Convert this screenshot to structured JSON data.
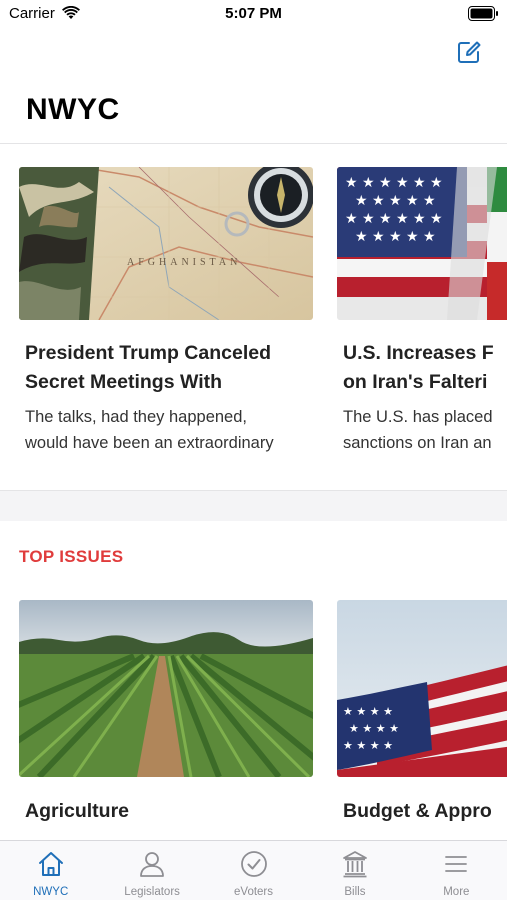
{
  "status_bar": {
    "carrier": "Carrier",
    "time": "5:07 PM"
  },
  "header": {
    "title": "NWYC",
    "compose_icon": "compose-icon"
  },
  "news": [
    {
      "title_line1": "President Trump Canceled",
      "title_line2": "Secret Meetings With",
      "summary_line1": "The talks, had they happened,",
      "summary_line2": "would have been an extraordinary",
      "image": "afghanistan-map-photo"
    },
    {
      "title_line1": "U.S. Increases F",
      "title_line2": "on Iran's Falteri",
      "summary_line1": "The U.S. has placed",
      "summary_line2": "sanctions on Iran an",
      "image": "us-iran-flags-photo"
    }
  ],
  "top_issues": {
    "label": "TOP ISSUES",
    "items": [
      {
        "title": "Agriculture",
        "image": "farm-field-photo"
      },
      {
        "title": "Budget & Appro",
        "image": "american-flag-photo"
      }
    ]
  },
  "tab_bar": {
    "active": "NWYC",
    "tabs": [
      {
        "label": "NWYC",
        "icon": "home-icon"
      },
      {
        "label": "Legislators",
        "icon": "person-icon"
      },
      {
        "label": "eVoters",
        "icon": "checkmark-circle-icon"
      },
      {
        "label": "Bills",
        "icon": "capitol-building-icon"
      },
      {
        "label": "More",
        "icon": "menu-icon"
      }
    ]
  },
  "colors": {
    "accent": "#1f6fb8",
    "section_label": "#e03c3c",
    "inactive_tab": "#8e8e93"
  }
}
